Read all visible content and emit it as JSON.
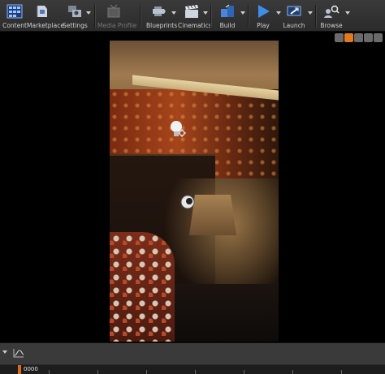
{
  "toolbar": {
    "buttons": [
      {
        "label": "Content",
        "icon": "content-browser-icon"
      },
      {
        "label": "Marketplace",
        "icon": "marketplace-icon"
      },
      {
        "label": "Settings",
        "icon": "settings-icon"
      },
      {
        "label": "Media Profile",
        "icon": "media-profile-icon",
        "disabled": true
      },
      {
        "label": "Blueprints",
        "icon": "blueprints-icon"
      },
      {
        "label": "Cinematics",
        "icon": "cinematics-icon"
      },
      {
        "label": "Build",
        "icon": "build-icon"
      },
      {
        "label": "Play",
        "icon": "play-icon"
      },
      {
        "label": "Launch",
        "icon": "launch-icon"
      },
      {
        "label": "Browse",
        "icon": "browse-icon"
      }
    ]
  },
  "viewport": {
    "scene": "interior room render",
    "active_view_icon_color": "#e07a1e"
  },
  "timeline": {
    "current_frame": "0000",
    "accent_color": "#d86a1f"
  }
}
